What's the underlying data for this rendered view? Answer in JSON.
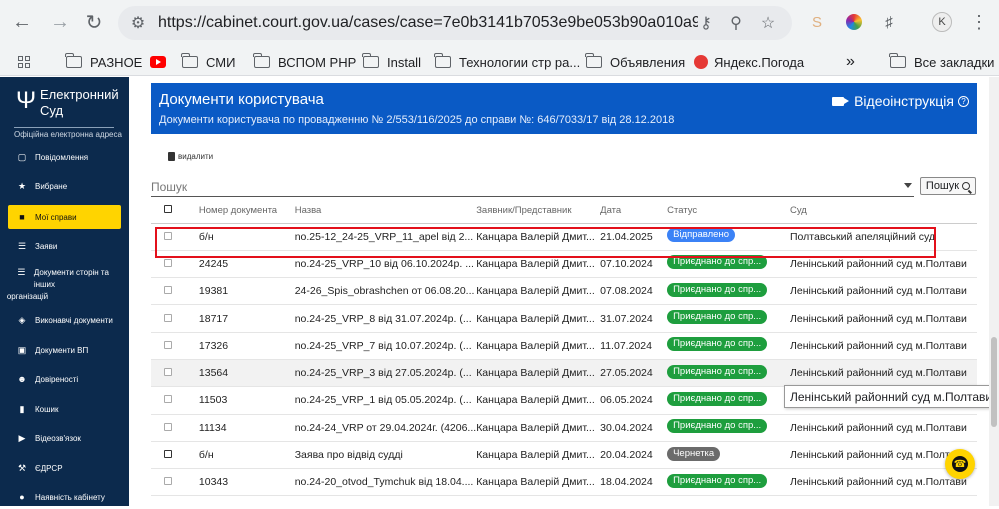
{
  "browser": {
    "url": "https://cabinet.court.gov.ua/cases/case=7e0b3141b7053e9be053b90a010a9bb3/pro...",
    "profile_initial": "K",
    "bookmarks": [
      "РАЗНОЕ",
      "СМИ",
      "ВСПОМ PHP",
      "Install",
      "Технологии стр ра...",
      "Объявления",
      "Яндекс.Погода"
    ],
    "all_bookmarks": "Все закладки",
    "more": "»"
  },
  "sidebar": {
    "logo_title_1": "Електронний",
    "logo_title_2": "Суд",
    "logo_subtitle": "Офіційна електронна адреса",
    "items": [
      {
        "label": "Повідомлення",
        "icon": "chat-icon"
      },
      {
        "label": "Вибране",
        "icon": "star-icon"
      },
      {
        "label": "Мої справи",
        "icon": "folder-icon",
        "active": true
      },
      {
        "label": "Заяви",
        "icon": "list-icon"
      },
      {
        "label": "Документи сторін та інших",
        "label2": "організацій",
        "icon": "documents-icon"
      },
      {
        "label": "Виконавчі документи",
        "icon": "stack-icon"
      },
      {
        "label": "Документи ВП",
        "icon": "doc-icon"
      },
      {
        "label": "Довіреності",
        "icon": "users-icon"
      },
      {
        "label": "Кошик",
        "icon": "trash-icon"
      },
      {
        "label": "Відеозв'язок",
        "icon": "video-icon"
      },
      {
        "label": "ЄДРСР",
        "icon": "gavel-icon"
      },
      {
        "label": "Наявність кабінету",
        "icon": "person-icon"
      }
    ]
  },
  "banner": {
    "title": "Документи користувача",
    "subtitle": "Документи користувача по провадженню № 2/553/116/2025 до справи №: 646/7033/17 від 28.12.2018",
    "video_label": "Відеоінструкція",
    "help": "?"
  },
  "toolbar": {
    "delete_label": "видалити"
  },
  "search": {
    "placeholder": "Пошук",
    "button_label": "Пошук"
  },
  "table": {
    "headers": [
      "Номер документа",
      "Назва",
      "Заявник/Представник",
      "Дата",
      "Статус",
      "Суд"
    ],
    "rows": [
      {
        "number": "б/н",
        "name": "no.25-12_24-25_VRP_11_apel від 2...",
        "applicant": "Канцара Валерій Дмит...",
        "date": "21.04.2025",
        "status": "Відправлено",
        "status_color": "#3b82f6",
        "court": "Полтавський апеляційний суд"
      },
      {
        "number": "24245",
        "name": "no.24-25_VRP_10 від 06.10.2024р. ...",
        "applicant": "Канцара Валерій Дмит...",
        "date": "07.10.2024",
        "status": "Приєднано до спр...",
        "status_color": "#1e9e3e",
        "court": "Ленінський районний суд м.Полтави"
      },
      {
        "number": "19381",
        "name": "24-26_Spis_obrashchen от 06.08.20...",
        "applicant": "Канцара Валерій Дмит...",
        "date": "07.08.2024",
        "status": "Приєднано до спр...",
        "status_color": "#1e9e3e",
        "court": "Ленінський районний суд м.Полтави"
      },
      {
        "number": "18717",
        "name": "no.24-25_VRP_8 від 31.07.2024р. (...",
        "applicant": "Канцара Валерій Дмит...",
        "date": "31.07.2024",
        "status": "Приєднано до спр...",
        "status_color": "#1e9e3e",
        "court": "Ленінський районний суд м.Полтави"
      },
      {
        "number": "17326",
        "name": "no.24-25_VRP_7 від 10.07.2024р. (...",
        "applicant": "Канцара Валерій Дмит...",
        "date": "11.07.2024",
        "status": "Приєднано до спр...",
        "status_color": "#1e9e3e",
        "court": "Ленінський районний суд м.Полтави"
      },
      {
        "number": "13564",
        "name": "no.24-25_VRP_3 від 27.05.2024р. (...",
        "applicant": "Канцара Валерій Дмит...",
        "date": "27.05.2024",
        "status": "Приєднано до спр...",
        "status_color": "#1e9e3e",
        "court": "Ленінський районний суд м.Полтави"
      },
      {
        "number": "11503",
        "name": "no.24-25_VRP_1 від 05.05.2024р. (...",
        "applicant": "Канцара Валерій Дмит...",
        "date": "06.05.2024",
        "status": "Приєднано до спр...",
        "status_color": "#1e9e3e",
        "court": "Ленінський районний суд м.Полтави"
      },
      {
        "number": "11134",
        "name": "no.24-24_VRP от 29.04.2024г. (4206...",
        "applicant": "Канцара Валерій Дмит...",
        "date": "30.04.2024",
        "status": "Приєднано до спр...",
        "status_color": "#1e9e3e",
        "court": "Ленінський районний суд м.Полтави"
      },
      {
        "number": "б/н",
        "name": "Заява про відвід судді",
        "applicant": "Канцара Валерій Дмит...",
        "date": "20.04.2024",
        "status": "Чернетка",
        "status_color": "#6b6b6b",
        "court": "Ленінський районний суд м.Полтави"
      },
      {
        "number": "10343",
        "name": "no.24-20_otvod_Tymchuk від 18.04....",
        "applicant": "Канцара Валерій Дмит...",
        "date": "18.04.2024",
        "status": "Приєднано до спр...",
        "status_color": "#1e9e3e",
        "court": "Ленінський районний суд м.Полтави"
      }
    ]
  },
  "tooltip": "Ленінський районний суд м.Полтави"
}
